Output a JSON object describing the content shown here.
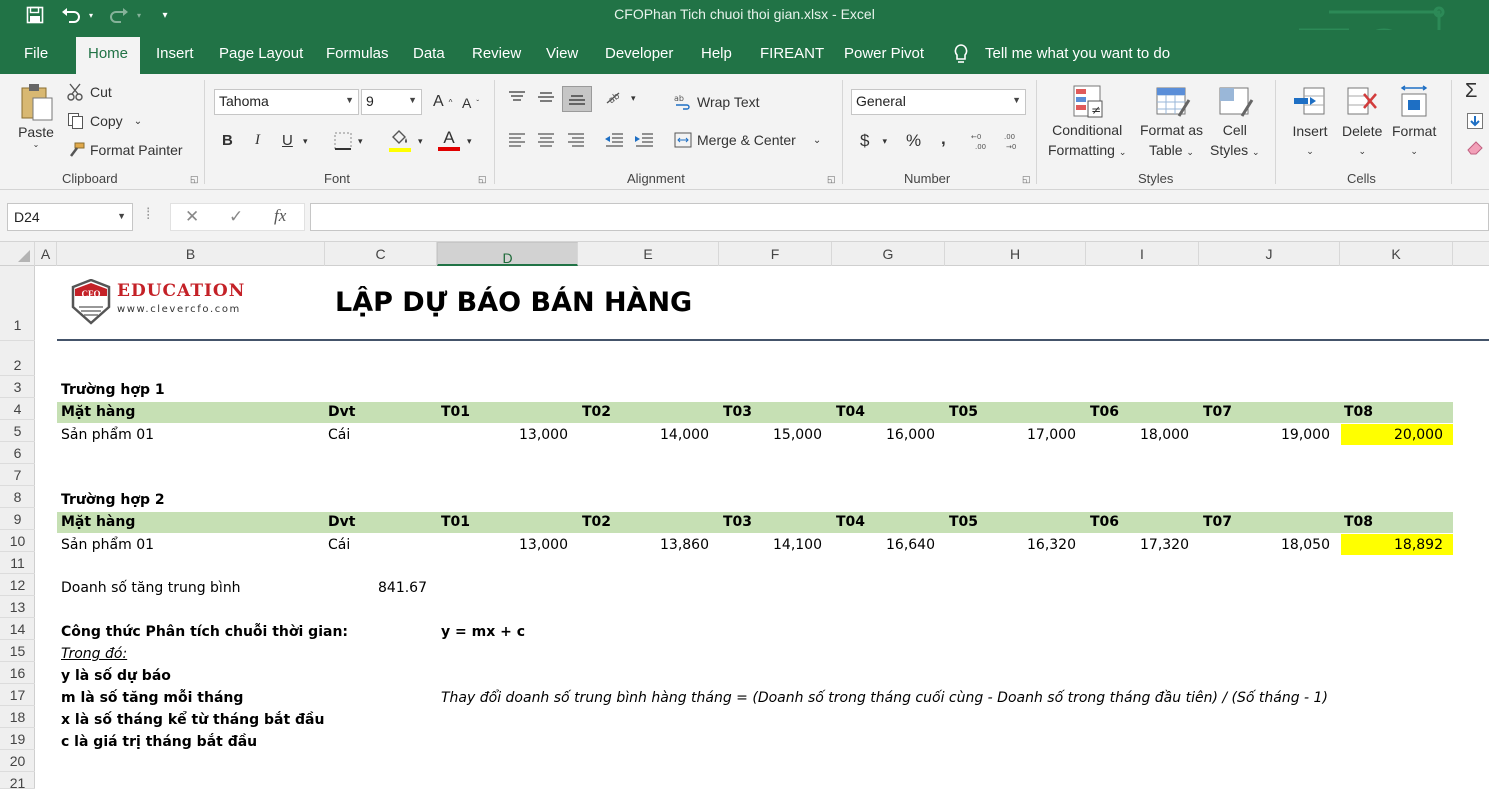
{
  "app": {
    "title": "CFOPhan Tich chuoi thoi gian.xlsx  -  Excel"
  },
  "tabs": [
    "File",
    "Home",
    "Insert",
    "Page Layout",
    "Formulas",
    "Data",
    "Review",
    "View",
    "Developer",
    "Help",
    "FIREANT",
    "Power Pivot"
  ],
  "tell_me": "Tell me what you want to do",
  "ribbon": {
    "clipboard": {
      "paste": "Paste",
      "cut": "Cut",
      "copy": "Copy",
      "format_painter": "Format Painter",
      "label": "Clipboard"
    },
    "font": {
      "name": "Tahoma",
      "size": "9",
      "bold": "B",
      "italic": "I",
      "underline": "U",
      "label": "Font"
    },
    "alignment": {
      "wrap": "Wrap Text",
      "merge": "Merge & Center",
      "label": "Alignment"
    },
    "number": {
      "format": "General",
      "currency": "$",
      "percent": "%",
      "comma": ",",
      "label": "Number"
    },
    "styles": {
      "cond1": "Conditional",
      "cond2": "Formatting",
      "fmt1": "Format as",
      "fmt2": "Table",
      "cell1": "Cell",
      "cell2": "Styles",
      "label": "Styles"
    },
    "cells": {
      "insert": "Insert",
      "delete": "Delete",
      "format": "Format",
      "label": "Cells"
    }
  },
  "name_box": "D24",
  "columns": [
    "A",
    "B",
    "C",
    "D",
    "E",
    "F",
    "G",
    "H",
    "I",
    "J",
    "K"
  ],
  "rows": [
    "1",
    "2",
    "3",
    "4",
    "5",
    "6",
    "7",
    "8",
    "9",
    "10",
    "11",
    "12",
    "13",
    "14",
    "15",
    "16",
    "17",
    "18",
    "19",
    "20",
    "21"
  ],
  "sheet": {
    "logo_text": "EDUCATION",
    "logo_mark": "CFO",
    "logo_url": "www.clevercfo.com",
    "heading": "LẬP DỰ BÁO BÁN HÀNG",
    "case1_title": "Trường hợp 1",
    "case2_title": "Trường hợp 2",
    "hdr_item": "Mặt hàng",
    "hdr_unit": "Dvt",
    "months": [
      "T01",
      "T02",
      "T03",
      "T04",
      "T05",
      "T06",
      "T07",
      "T08"
    ],
    "product": "Sản phẩm 01",
    "unit": "Cái",
    "case1_values": [
      "13,000",
      "14,000",
      "15,000",
      "16,000",
      "17,000",
      "18,000",
      "19,000",
      "20,000"
    ],
    "case2_values": [
      "13,000",
      "13,860",
      "14,100",
      "16,640",
      "16,320",
      "17,320",
      "18,050",
      "18,892"
    ],
    "avg_label": "Doanh số tăng trung bình",
    "avg_value": "841.67",
    "formula_label": "Công thức Phân tích chuỗi thời gian:",
    "formula": "y = mx + c",
    "where": "Trong đó:",
    "def_y": "y là số dự báo",
    "def_m": "m là số tăng mỗi tháng",
    "def_x": "x là số tháng kể từ tháng bắt đầu",
    "def_c": "c là giá trị tháng bắt đầu",
    "note": "Thay đổi doanh số trung bình hàng tháng = (Doanh số trong tháng cuối cùng - Doanh số trong tháng đầu tiên) / (Số tháng - 1)"
  }
}
